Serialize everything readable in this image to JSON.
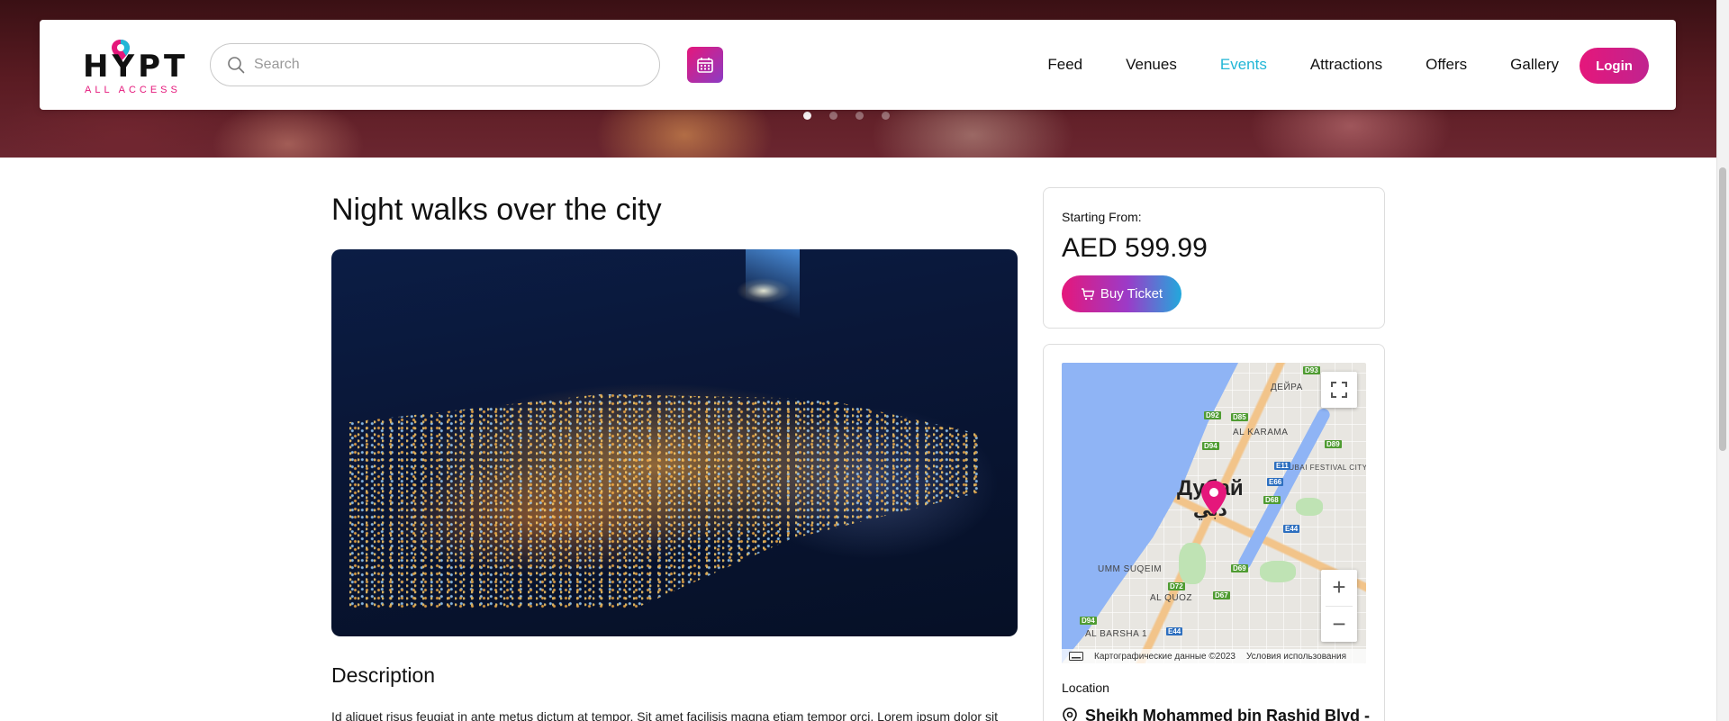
{
  "brand": {
    "name": "HYPT",
    "tagline": "ALL ACCESS",
    "pink": "#e5177b",
    "cyan": "#22b6d6"
  },
  "search": {
    "placeholder": "Search",
    "value": ""
  },
  "nav": {
    "items": [
      {
        "label": "Feed",
        "active": false
      },
      {
        "label": "Venues",
        "active": false
      },
      {
        "label": "Events",
        "active": true
      },
      {
        "label": "Attractions",
        "active": false
      },
      {
        "label": "Offers",
        "active": false
      },
      {
        "label": "Gallery",
        "active": false
      }
    ],
    "login_label": "Login"
  },
  "hero": {
    "slide_count": 4,
    "active_slide": 1
  },
  "event": {
    "title": "Night walks over the city",
    "description_heading": "Description",
    "description_text": "Id aliquet risus feugiat in ante metus dictum at tempor. Sit amet facilisis magna etiam tempor orci. Lorem ipsum dolor sit"
  },
  "pricing": {
    "label": "Starting From:",
    "value": "AED 599.99",
    "buy_label": "Buy Ticket"
  },
  "map": {
    "city_name_ru": "Дубай",
    "city_name_ar": "دبي",
    "labels": {
      "deira": "ДЕЙРА",
      "al_karama": "AL KARAMA",
      "dubai_festival_city": "DUBAI FESTIVAL CITY",
      "umm_suqeim": "UMM SUQEIM",
      "al_quoz": "AL QUOZ",
      "al_barsha": "AL BARSHA 1"
    },
    "roads": [
      "D93",
      "D85",
      "D92",
      "D94",
      "E11",
      "E66",
      "D68",
      "D89",
      "E44",
      "D69",
      "D72",
      "D67",
      "D94",
      "E44"
    ],
    "zoom_in": "+",
    "zoom_out": "−",
    "footer_data": "Картографические данные ©2023",
    "footer_terms": "Условия использования"
  },
  "location": {
    "label": "Location",
    "address": "Sheikh Mohammed bin Rashid Blvd -"
  }
}
